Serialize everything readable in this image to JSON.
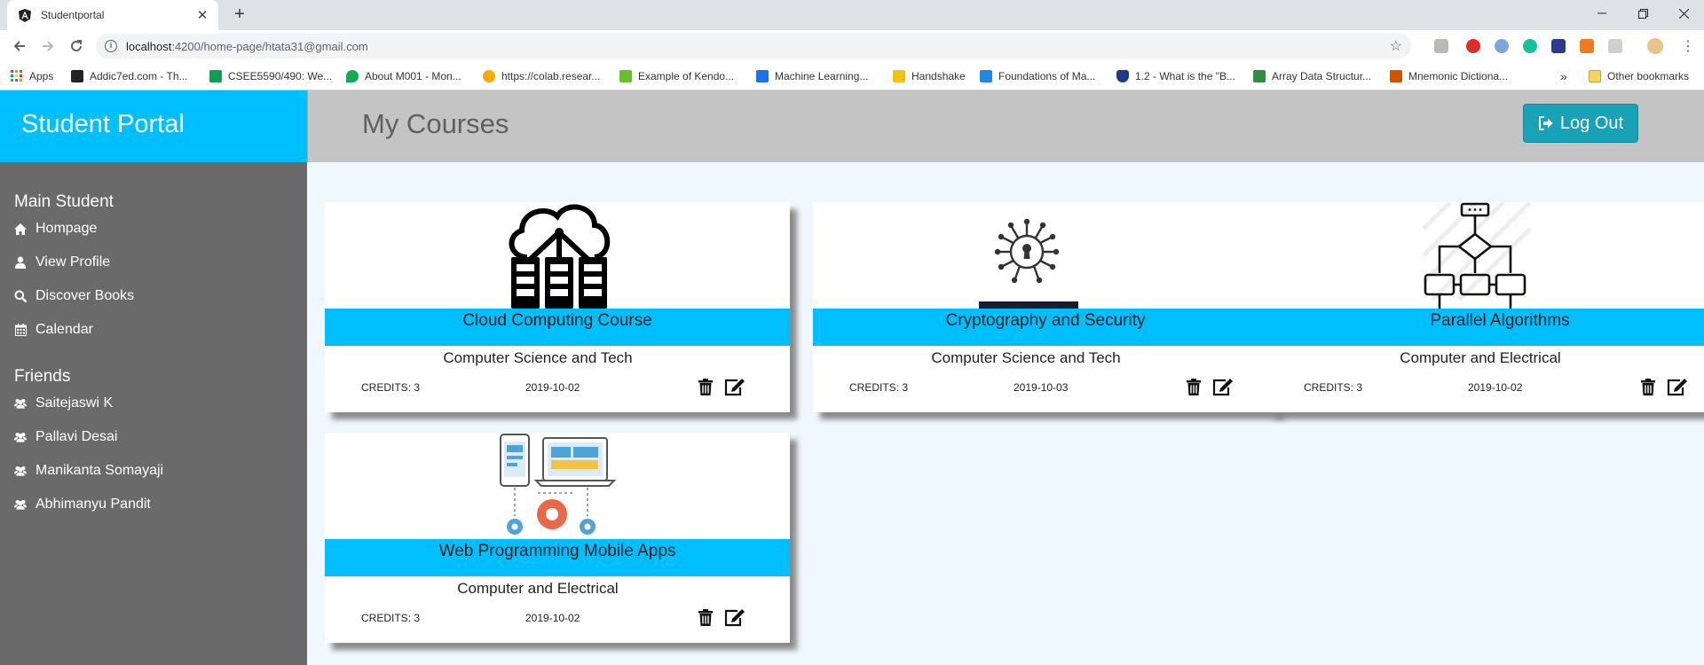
{
  "browser": {
    "tab_title": "Studentportal",
    "url_host": "localhost",
    "url_path": ":4200/home-page/htata31@gmail.com",
    "bookmarks": [
      {
        "label": "Apps",
        "color": "#e53935"
      },
      {
        "label": "Addic7ed.com - Th...",
        "color": "#222222"
      },
      {
        "label": "CSEE5590/490: We...",
        "color": "#0f9d58"
      },
      {
        "label": "About M001 - Mon...",
        "color": "#13aa52"
      },
      {
        "label": "https://colab.resear...",
        "color": "#f9ab00"
      },
      {
        "label": "Example of Kendo...",
        "color": "#6abf2e"
      },
      {
        "label": "Machine Learning...",
        "color": "#1a73e8"
      },
      {
        "label": "Handshake",
        "color": "#f4c20d"
      },
      {
        "label": "Foundations of Ma...",
        "color": "#1e88e5"
      },
      {
        "label": "1.2 - What is the \"B...",
        "color": "#1e3a8a"
      },
      {
        "label": "Array Data Structur...",
        "color": "#2f8d46"
      },
      {
        "label": "Mnemonic Dictiona...",
        "color": "#d35400"
      }
    ],
    "bookmarks_overflow": "»",
    "other_bookmarks": "Other bookmarks"
  },
  "app": {
    "brand": "Student Portal",
    "page_title": "My Courses",
    "logout_label": "Log Out",
    "accent_color": "#00bfff"
  },
  "sidebar": {
    "main_heading": "Main Student",
    "main_items": [
      {
        "label": "Hompage",
        "icon": "home-icon"
      },
      {
        "label": "View Profile",
        "icon": "user-icon"
      },
      {
        "label": "Discover Books",
        "icon": "search-icon"
      },
      {
        "label": "Calendar",
        "icon": "calendar-icon"
      }
    ],
    "friends_heading": "Friends",
    "friends": [
      {
        "label": "Saitejaswi K",
        "icon": "users-icon"
      },
      {
        "label": "Pallavi Desai",
        "icon": "users-icon"
      },
      {
        "label": "Manikanta Somayaji",
        "icon": "users-icon"
      },
      {
        "label": "Abhimanyu Pandit",
        "icon": "users-icon"
      }
    ]
  },
  "courses": [
    {
      "title": "Cloud Computing Course",
      "department": "Computer Science and Tech",
      "credits": "CREDITS: 3",
      "date": "2019-10-02",
      "image": "cloud-server-icon"
    },
    {
      "title": "Cryptography and Security",
      "department": "Computer Science and Tech",
      "credits": "CREDITS: 3",
      "date": "2019-10-03",
      "image": "circuit-key-icon"
    },
    {
      "title": "Parallel Algorithms",
      "department": "Computer and Electrical",
      "credits": "CREDITS: 3",
      "date": "2019-10-02",
      "image": "flowchart-icon"
    },
    {
      "title": "Web Programming Mobile Apps",
      "department": "Computer and Electrical",
      "credits": "CREDITS: 3",
      "date": "2019-10-02",
      "image": "devices-gears-icon"
    }
  ]
}
